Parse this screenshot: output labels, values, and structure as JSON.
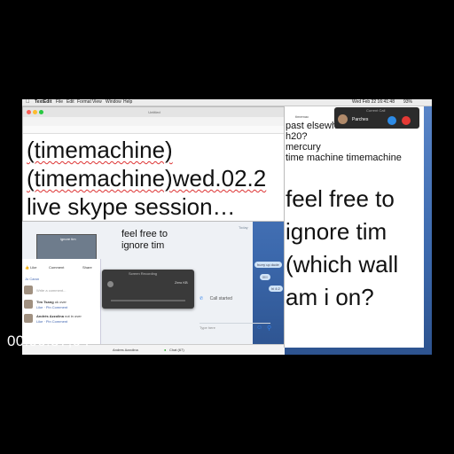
{
  "menubar": {
    "app": "TextEdit",
    "items": [
      "File",
      "Edit",
      "Format",
      "View",
      "Window",
      "Help"
    ],
    "clock": "Wed Feb 22  16:41:48",
    "battery": "93%"
  },
  "textedit": {
    "window_title": "Untitled",
    "lines": [
      "(timemachine)",
      "(timemachine)wed.02.2",
      "live skype session…"
    ]
  },
  "right_panel": {
    "tab_label": "timemac",
    "small_lines": [
      "past elsewhere",
      "h20?",
      "mercury",
      "time machine timemachine"
    ],
    "big_lines": [
      "feel free to",
      "ignore tim",
      "(which wall",
      "am i on?"
    ]
  },
  "current_call": {
    "title": "Current Call",
    "name": "Parches"
  },
  "skype": {
    "message_lines": [
      "feel free to",
      "ignore tim"
    ],
    "today": "Today",
    "bubbles": [
      "hurry up dude",
      "!!!!!",
      "hi 4:2"
    ],
    "call_started": "Call started",
    "type_here": "Type here",
    "contact": "Andres Azzolina",
    "chat_count": "Chat (67)"
  },
  "screen_recording": {
    "title": "Screen Recording",
    "size": "Zero KB"
  },
  "facebook": {
    "gif_label": "ignore tim",
    "actions": [
      "Like",
      "Comment",
      "Share"
    ],
    "poster": "Jo Caron",
    "write_comment": "Write a comment...",
    "comments": [
      {
        "name": "Tim Tsang",
        "text": "ok over",
        "meta": "Like · Pin Comment"
      },
      {
        "name": "Andrés Azzolina",
        "text": "not in over",
        "meta": "Like · Pin Comment"
      }
    ]
  },
  "overlay": {
    "timecode": "00:00:57;04"
  },
  "colors": {
    "accent_blue": "#2f80ed",
    "decline_red": "#e53935",
    "info_blue": "#2d8be6"
  }
}
